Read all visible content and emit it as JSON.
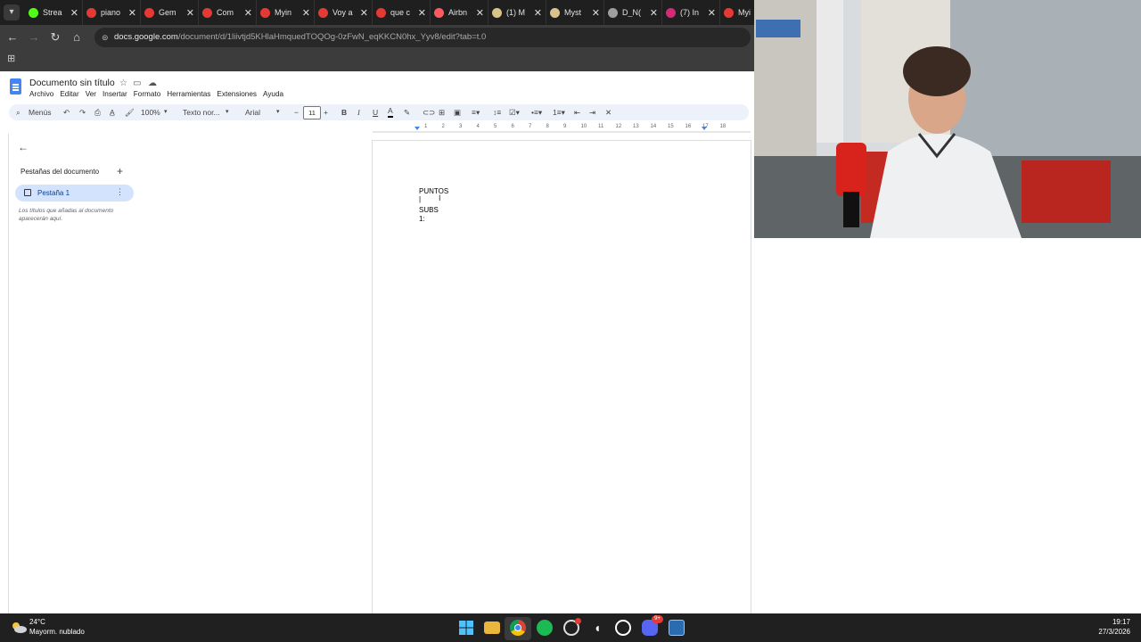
{
  "browser": {
    "tabs": [
      {
        "title": "Strea",
        "color": "#53fc18"
      },
      {
        "title": "piano",
        "color": "#e53935"
      },
      {
        "title": "Gem",
        "color": "#e53935"
      },
      {
        "title": "Com",
        "color": "#e53935"
      },
      {
        "title": "Myin",
        "color": "#e53935"
      },
      {
        "title": "Voy a",
        "color": "#e53935"
      },
      {
        "title": "que c",
        "color": "#e53935"
      },
      {
        "title": "Airbn",
        "color": "#ff5a5f"
      },
      {
        "title": "(1) M",
        "color": "#d8c48a"
      },
      {
        "title": "Myst",
        "color": "#d8c48a"
      },
      {
        "title": "D_N(",
        "color": "#9e9e9e"
      },
      {
        "title": "(7) In",
        "color": "#d62976"
      },
      {
        "title": "Myi",
        "color": "#e53935"
      }
    ],
    "url_host": "docs.google.com",
    "url_path": "/document/d/1liivtjd5KHlaHmquedTOQOg-0zFwN_eqKKCN0hx_Yyv8/edit?tab=t.0"
  },
  "docs": {
    "title": "Documento sin título",
    "menu": [
      "Archivo",
      "Editar",
      "Ver",
      "Insertar",
      "Formato",
      "Herramientas",
      "Extensiones",
      "Ayuda"
    ],
    "toolbar": {
      "menus_label": "Menús",
      "zoom": "100%",
      "style": "Texto nor...",
      "font": "Arial",
      "font_size": "11"
    },
    "ruler_labels": [
      "1",
      "2",
      "3",
      "4",
      "5",
      "6",
      "7",
      "8",
      "9",
      "10",
      "11",
      "12",
      "13",
      "14",
      "15",
      "16",
      "17",
      "18"
    ],
    "left_panel": {
      "header": "Pestañas del documento",
      "tab_name": "Pestaña 1",
      "hint": "Los títulos que añadas al documento aparecerán aquí."
    },
    "content_lines": [
      "PUNTOS",
      "|",
      "SUBS",
      "1:"
    ]
  },
  "taskbar": {
    "temperature": "24°C",
    "weather": "Mayorm. nublado",
    "time": "19:17",
    "date": "27/3/2026",
    "discord_badge": "9+"
  }
}
